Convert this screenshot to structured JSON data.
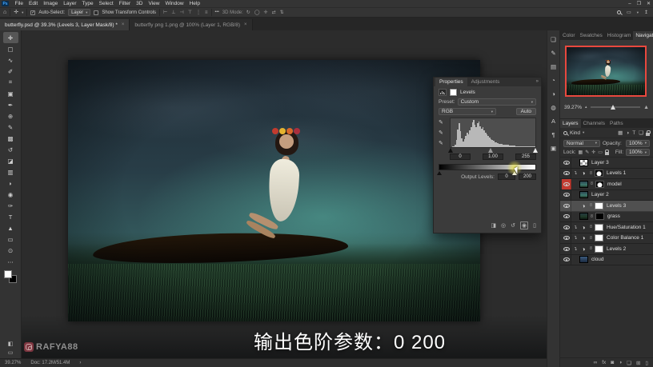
{
  "colors": {
    "accent_red": "#e8483e",
    "selected_row": "#505050",
    "highlight_yellow": "#eee750",
    "ui_bg": "#343434",
    "panel_bg": "#2e2e2e",
    "pasteboard": "#2c2c2c"
  },
  "app": {
    "logo_text": "Ps",
    "window_controls": [
      {
        "name": "minimize-button",
        "glyph": "–"
      },
      {
        "name": "restore-button",
        "glyph": "❐"
      },
      {
        "name": "close-button",
        "glyph": "✕"
      }
    ]
  },
  "menubar": {
    "items": [
      "File",
      "Edit",
      "Image",
      "Layer",
      "Type",
      "Select",
      "Filter",
      "3D",
      "View",
      "Window",
      "Help"
    ]
  },
  "options_bar": {
    "auto_select_label": "Auto-Select:",
    "auto_select_value": "Layer",
    "transform_label": "Show Transform Controls",
    "align_icons": [
      {
        "name": "align-left-icon",
        "glyph": "⊢"
      },
      {
        "name": "align-center-h-icon",
        "glyph": "⊥"
      },
      {
        "name": "align-right-icon",
        "glyph": "⊣"
      },
      {
        "name": "align-top-icon",
        "glyph": "⊤"
      },
      {
        "name": "distribute-h-icon",
        "glyph": "⋮"
      },
      {
        "name": "distribute-v-icon",
        "glyph": "≡"
      }
    ],
    "more_glyph": "•••",
    "mode3d_label": "3D Mode:",
    "mode3d_icons": [
      {
        "name": "orbit-3d-icon",
        "glyph": "↻"
      },
      {
        "name": "roll-3d-icon",
        "glyph": "◯"
      },
      {
        "name": "pan-3d-icon",
        "glyph": "✛"
      },
      {
        "name": "slide-3d-icon",
        "glyph": "⇄"
      },
      {
        "name": "dolly-3d-icon",
        "glyph": "⇅"
      }
    ]
  },
  "document_tabs": [
    {
      "label": "butterfly.psd @ 39.3% (Levels 3, Layer Mask/8) *",
      "active": true
    },
    {
      "label": "butterfly png 1.png @ 100% (Layer 1, RGB/8)",
      "active": false
    }
  ],
  "toolbar": {
    "tools": [
      {
        "name": "move-tool",
        "glyph": "✛",
        "active": true
      },
      {
        "name": "marquee-tool",
        "glyph": "▢"
      },
      {
        "name": "lasso-tool",
        "glyph": "∿"
      },
      {
        "name": "quick-selection-tool",
        "glyph": "✐"
      },
      {
        "name": "crop-tool",
        "glyph": "⌗"
      },
      {
        "name": "frame-tool",
        "glyph": "▣"
      },
      {
        "name": "eyedropper-tool",
        "glyph": "✒"
      },
      {
        "name": "healing-brush-tool",
        "glyph": "⊕"
      },
      {
        "name": "brush-tool",
        "glyph": "✎"
      },
      {
        "name": "clone-stamp-tool",
        "glyph": "▩"
      },
      {
        "name": "history-brush-tool",
        "glyph": "↺"
      },
      {
        "name": "eraser-tool",
        "glyph": "◪"
      },
      {
        "name": "gradient-tool",
        "glyph": "▥"
      },
      {
        "name": "blur-tool",
        "glyph": "◗"
      },
      {
        "name": "dodge-tool",
        "glyph": "◉"
      },
      {
        "name": "pen-tool",
        "glyph": "✑"
      },
      {
        "name": "type-tool",
        "glyph": "T"
      },
      {
        "name": "path-select-tool",
        "glyph": "▲"
      },
      {
        "name": "shape-tool",
        "glyph": "▭"
      },
      {
        "name": "zoom-tool",
        "glyph": "⊙"
      },
      {
        "name": "edit-toolbar",
        "glyph": "⋯"
      }
    ]
  },
  "properties_panel": {
    "tabs": [
      {
        "label": "Properties",
        "active": true
      },
      {
        "label": "Adjustments",
        "active": false
      }
    ],
    "collapse_glyph": "»",
    "title": "Levels",
    "preset_label": "Preset:",
    "preset_value": "Custom",
    "channel_value": "RGB",
    "auto_label": "Auto",
    "input_black": "0",
    "input_gamma": "1.00",
    "input_white": "255",
    "output_label": "Output Levels:",
    "output_black": "0",
    "output_white": "200",
    "histogram": [
      1,
      2,
      3,
      8,
      25,
      60,
      82,
      55,
      30,
      20,
      28,
      40,
      50,
      45,
      58,
      70,
      85,
      95,
      78,
      70,
      82,
      88,
      72,
      65,
      70,
      58,
      50,
      44,
      38,
      33,
      28,
      24,
      21,
      18,
      16,
      14,
      12,
      11,
      10,
      9,
      8,
      8,
      7,
      7,
      6,
      6,
      5,
      5,
      5,
      4,
      4,
      4,
      3,
      3,
      3,
      3,
      3,
      2,
      2,
      2,
      2,
      2,
      2,
      2
    ],
    "footer_icons": [
      {
        "name": "clip-to-layer-icon",
        "glyph": "◨"
      },
      {
        "name": "view-previous-state-icon",
        "glyph": "◎"
      },
      {
        "name": "reset-adjustment-icon",
        "glyph": "↺"
      },
      {
        "name": "toggle-visibility-icon",
        "glyph": "◉",
        "boxed": true
      },
      {
        "name": "delete-adjustment-icon",
        "glyph": "▯"
      }
    ]
  },
  "right_dock": {
    "icons": [
      {
        "name": "libraries-panel-icon",
        "glyph": "❏"
      },
      {
        "name": "brush-settings-panel-icon",
        "glyph": "✎"
      },
      {
        "name": "brushes-panel-icon",
        "glyph": "▤"
      },
      {
        "name": "timeline-panel-icon",
        "glyph": "◔"
      },
      {
        "name": "adjustments-panel-icon",
        "glyph": "◑"
      },
      {
        "name": "styles-panel-icon",
        "glyph": "◍"
      },
      {
        "name": "character-panel-icon",
        "glyph": "A"
      },
      {
        "name": "paragraph-panel-icon",
        "glyph": "¶"
      },
      {
        "name": "info-panel-icon",
        "glyph": "▣"
      }
    ]
  },
  "navigator": {
    "panel_tabs": [
      {
        "label": "Color",
        "active": false
      },
      {
        "label": "Swatches",
        "active": false
      },
      {
        "label": "Histogram",
        "active": false
      },
      {
        "label": "Navigator",
        "active": true
      }
    ],
    "zoom_value": "39.27%",
    "mountain_small": "▴",
    "mountain_large": "▲"
  },
  "layers_panel": {
    "tabs": [
      {
        "label": "Layers",
        "active": true
      },
      {
        "label": "Channels",
        "active": false
      },
      {
        "label": "Paths",
        "active": false
      }
    ],
    "filter_label": "Kind",
    "filter_icons": [
      {
        "name": "filter-pixel-layers-icon",
        "glyph": "▦"
      },
      {
        "name": "filter-adjustment-layers-icon",
        "glyph": "◑"
      },
      {
        "name": "filter-type-layers-icon",
        "glyph": "T"
      },
      {
        "name": "filter-shape-layers-icon",
        "glyph": "❏"
      }
    ],
    "blend_mode": "Normal",
    "opacity_label": "Opacity:",
    "opacity_value": "100%",
    "lock_label": "Lock:",
    "lock_icons": [
      {
        "name": "lock-transparency-icon",
        "glyph": "▦"
      },
      {
        "name": "lock-image-icon",
        "glyph": "✎"
      },
      {
        "name": "lock-position-icon",
        "glyph": "✛"
      },
      {
        "name": "lock-artboard-icon",
        "glyph": "▭"
      }
    ],
    "fill_label": "Fill:",
    "fill_value": "100%",
    "layers": [
      {
        "name": "Layer 3",
        "thumb": "checker",
        "mask": null,
        "clipped": false,
        "selected": false,
        "red_eye": false
      },
      {
        "name": "Levels 1",
        "thumb": "adjustment",
        "mask": "blob",
        "clipped": true,
        "selected": false,
        "red_eye": false
      },
      {
        "name": "model",
        "thumb": "scene",
        "mask": "blob",
        "clipped": false,
        "selected": false,
        "red_eye": true
      },
      {
        "name": "Layer 2",
        "thumb": "scene",
        "mask": null,
        "clipped": false,
        "selected": false,
        "red_eye": false
      },
      {
        "name": "Levels 3",
        "thumb": "adjustment",
        "mask": "white",
        "clipped": false,
        "selected": true,
        "red_eye": false
      },
      {
        "name": "grass",
        "thumb": "scene-dark",
        "mask": "black",
        "clipped": false,
        "selected": false,
        "red_eye": false
      },
      {
        "name": "Hue/Saturation 1",
        "thumb": "adjustment",
        "mask": "white",
        "clipped": true,
        "selected": false,
        "red_eye": false
      },
      {
        "name": "Color Balance 1",
        "thumb": "adjustment",
        "mask": "white",
        "clipped": true,
        "selected": false,
        "red_eye": false
      },
      {
        "name": "Levels 2",
        "thumb": "adjustment",
        "mask": "white",
        "clipped": true,
        "selected": false,
        "red_eye": false
      },
      {
        "name": "cloud",
        "thumb": "cloud",
        "mask": null,
        "clipped": false,
        "selected": false,
        "red_eye": false
      }
    ],
    "footer_icons": [
      {
        "name": "link-layers-icon",
        "glyph": "∞"
      },
      {
        "name": "layer-effects-icon",
        "glyph": "fx"
      },
      {
        "name": "add-layer-mask-icon",
        "glyph": "◙"
      },
      {
        "name": "add-adjustment-layer-icon",
        "glyph": "◑"
      },
      {
        "name": "new-group-icon",
        "glyph": "❏"
      },
      {
        "name": "new-layer-icon",
        "glyph": "⊞"
      },
      {
        "name": "delete-layer-icon",
        "glyph": "▯"
      }
    ]
  },
  "status_bar": {
    "zoom": "39.27%",
    "doc": "Doc: 17.2M/51.4M",
    "chevron": "›"
  },
  "overlay": {
    "caption": "输出色阶参数：0 200",
    "watermark": "RAFYA88"
  }
}
